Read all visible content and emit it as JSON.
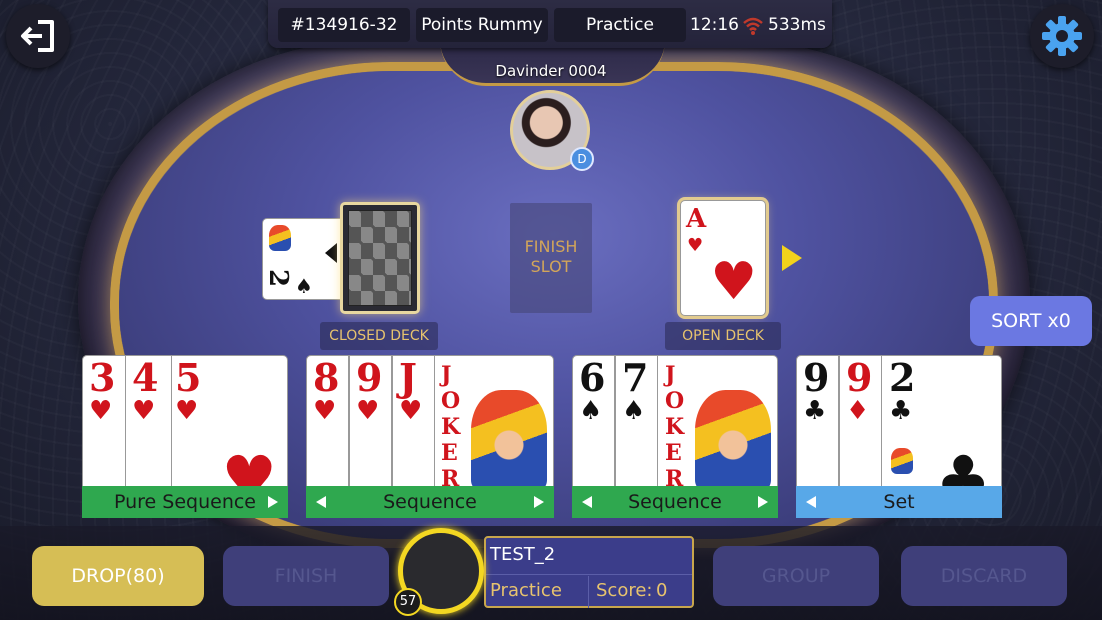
{
  "topbar": {
    "table_id": "#134916-32",
    "game_type": "Points Rummy",
    "mode": "Practice",
    "time": "12:16",
    "ping": "533ms"
  },
  "opponent": {
    "name": "Davinder 0004",
    "badge": "D"
  },
  "table": {
    "closed_deck_label": "CLOSED DECK",
    "open_deck_label": "OPEN DECK",
    "finish_slot_label": "FINISH SLOT",
    "joker_card": {
      "rank": "2",
      "suit": "♠"
    },
    "open_card": {
      "rank": "A",
      "suit": "♥"
    }
  },
  "sort_button": "SORT x0",
  "groups": [
    {
      "label": "Pure Sequence",
      "color": "#2fa84f",
      "cards": [
        {
          "rank": "3",
          "suit": "♥"
        },
        {
          "rank": "4",
          "suit": "♥"
        },
        {
          "rank": "5",
          "suit": "♥"
        }
      ]
    },
    {
      "label": "Sequence",
      "color": "#2fa84f",
      "cards": [
        {
          "rank": "8",
          "suit": "♥"
        },
        {
          "rank": "9",
          "suit": "♥"
        },
        {
          "rank": "J",
          "suit": "♥"
        },
        {
          "rank": "JOKER",
          "suit": ""
        }
      ]
    },
    {
      "label": "Sequence",
      "color": "#2fa84f",
      "cards": [
        {
          "rank": "6",
          "suit": "♠"
        },
        {
          "rank": "7",
          "suit": "♠"
        },
        {
          "rank": "JOKER",
          "suit": ""
        }
      ]
    },
    {
      "label": "Set",
      "color": "#58a8e8",
      "cards": [
        {
          "rank": "9",
          "suit": "♣"
        },
        {
          "rank": "9",
          "suit": "♦"
        },
        {
          "rank": "2",
          "suit": "♣"
        }
      ]
    }
  ],
  "bottom": {
    "drop_label": "DROP(80)",
    "finish_label": "FINISH",
    "group_label": "GROUP",
    "discard_label": "DISCARD",
    "player_name": "TEST_2",
    "player_mode": "Practice",
    "score_label": "Score:",
    "score_value": "0",
    "timer": "57"
  }
}
